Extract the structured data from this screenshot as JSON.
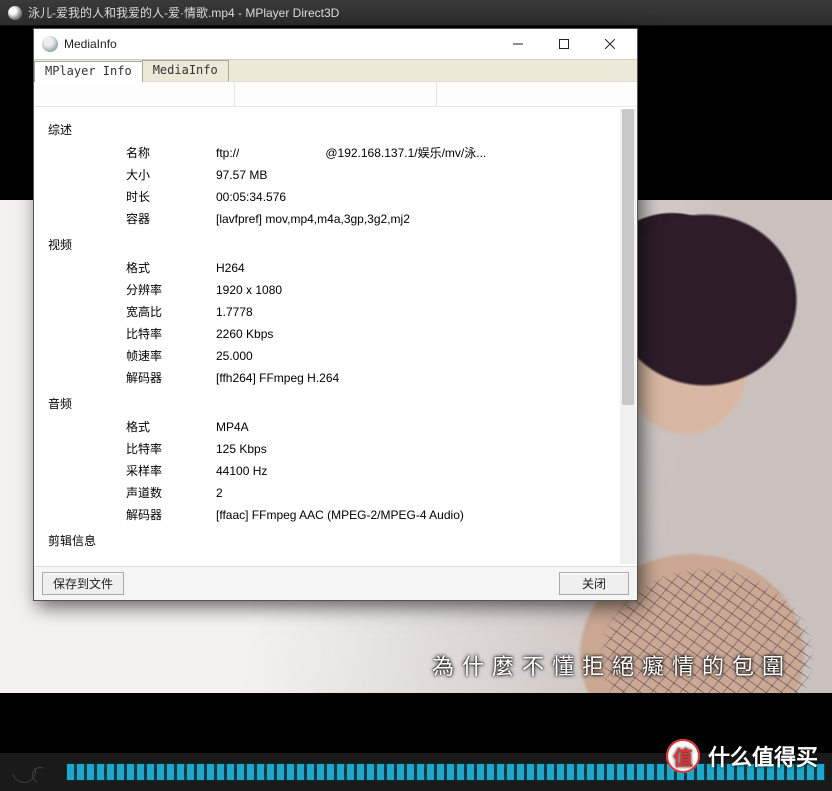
{
  "player": {
    "title": "泳儿-爱我的人和我爱的人-爱·情歌.mp4 - MPlayer Direct3D",
    "subtitle_line": "為什麼不懂拒絕癡情的包圍"
  },
  "watermark": {
    "badge_char": "值",
    "text": "什么值得买"
  },
  "dialog": {
    "title": "MediaInfo",
    "tabs": {
      "mplayer": "MPlayer Info",
      "mediainfo": "MediaInfo"
    },
    "buttons": {
      "save_to_file": "保存到文件",
      "close": "关闭"
    },
    "sections": {
      "overview": {
        "heading": "综述",
        "rows": {
          "name": {
            "k": "名称",
            "v_pre": "ftp://",
            "v_post": "@192.168.137.1/娱乐/mv/泳..."
          },
          "size": {
            "k": "大小",
            "v": "97.57 MB"
          },
          "duration": {
            "k": "时长",
            "v": "00:05:34.576"
          },
          "container": {
            "k": "容器",
            "v": "[lavfpref] mov,mp4,m4a,3gp,3g2,mj2"
          }
        }
      },
      "video": {
        "heading": "视频",
        "rows": {
          "format": {
            "k": "格式",
            "v": "H264"
          },
          "res": {
            "k": "分辨率",
            "v": "1920 x 1080"
          },
          "aspect": {
            "k": "宽高比",
            "v": "1.7778"
          },
          "bitrate": {
            "k": "比特率",
            "v": "2260 Kbps"
          },
          "fps": {
            "k": "帧速率",
            "v": "25.000"
          },
          "decoder": {
            "k": "解码器",
            "v": "[ffh264] FFmpeg H.264"
          }
        }
      },
      "audio": {
        "heading": "音频",
        "rows": {
          "format": {
            "k": "格式",
            "v": "MP4A"
          },
          "bitrate": {
            "k": "比特率",
            "v": "125 Kbps"
          },
          "sample": {
            "k": "采样率",
            "v": "44100 Hz"
          },
          "channels": {
            "k": "声道数",
            "v": "2"
          },
          "decoder": {
            "k": "解码器",
            "v": "[ffaac] FFmpeg AAC (MPEG-2/MPEG-4 Audio)"
          }
        }
      },
      "clip": {
        "heading": "剪辑信息"
      }
    }
  }
}
